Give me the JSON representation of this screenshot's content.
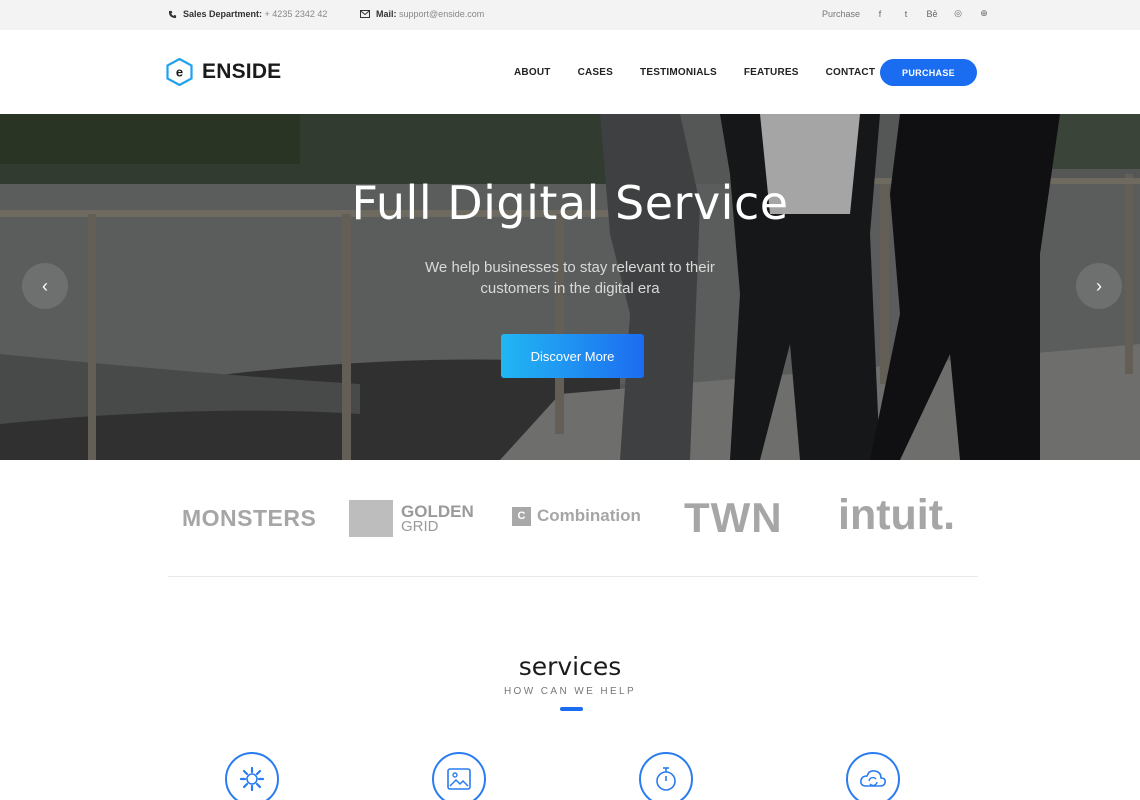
{
  "topbar": {
    "phone_label": "Sales Department:",
    "phone_value": "+ 4235 2342 42",
    "mail_label": "Mail:",
    "mail_value": "support@enside.com",
    "purchase_link": "Purchase",
    "social": [
      "f",
      "t",
      "Bē",
      "◎",
      "⊕"
    ]
  },
  "header": {
    "logo_letter": "e",
    "logo_text": "ENSIDE",
    "nav": [
      "ABOUT",
      "CASES",
      "TESTIMONIALS",
      "FEATURES",
      "CONTACT"
    ],
    "purchase_button": "PURCHASE"
  },
  "hero": {
    "title": "Full Digital Service",
    "subtitle": "We help businesses to stay relevant to their customers in the digital era",
    "cta": "Discover More",
    "prev_glyph": "‹",
    "next_glyph": "›"
  },
  "clients": {
    "monsters": "MONSTERS",
    "golden_top": "GOLDEN",
    "golden_bottom": "GRID",
    "combination_mark": "C",
    "combination": "Combination",
    "twn": "TWN",
    "intuit": "intuit."
  },
  "services": {
    "title": "services",
    "subtitle": "HOW CAN WE HELP",
    "icons": [
      "gear-icon",
      "image-icon",
      "stopwatch-icon",
      "cloud-sync-icon"
    ]
  },
  "colors": {
    "accent": "#1a6cf0",
    "cta_gradient_start": "#21b7f3",
    "cta_gradient_end": "#1d6cf0",
    "topbar_bg": "#f3f3f3"
  }
}
